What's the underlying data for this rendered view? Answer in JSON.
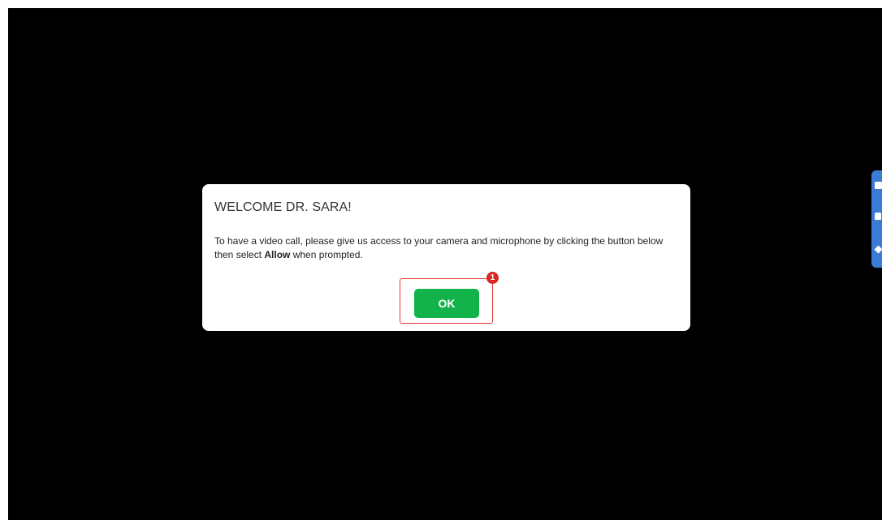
{
  "dialog": {
    "title": "WELCOME DR. SARA!",
    "message_before": "To have a video call, please give us access to your camera and microphone by clicking the button below then select ",
    "message_bold": "Allow",
    "message_after": " when prompted.",
    "ok_label": "OK"
  },
  "annotation": {
    "step_number": "1",
    "highlight_color": "#e53935",
    "badge_color": "#d62828"
  },
  "colors": {
    "background": "#000000",
    "ok_button": "#12b34a",
    "side_tab": "#3a7bd5"
  }
}
